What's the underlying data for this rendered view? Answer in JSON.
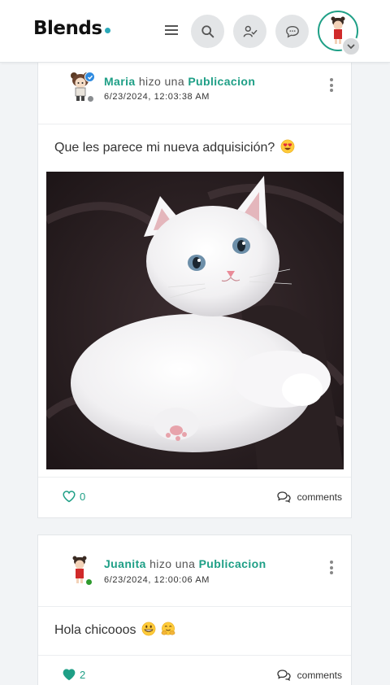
{
  "header": {
    "logo": "Blends",
    "colors": {
      "accent": "#1e9f86",
      "logo_dot": "#2aa8b8"
    },
    "icons": [
      "menu-icon",
      "search-icon",
      "friend-requests-icon",
      "messages-icon",
      "chevron-down-icon"
    ]
  },
  "posts": [
    {
      "author": "Maria",
      "action": "hizo una",
      "type": "Publicacion",
      "date": "6/23/2024, 12:03:38 AM",
      "verified": true,
      "status": "offline",
      "text": "Que les parece mi nueva adquisición?",
      "emojis": [
        "heart-eyes-emoji"
      ],
      "has_image": true,
      "likes": "0",
      "liked": false,
      "comments_label": "comments"
    },
    {
      "author": "Juanita",
      "action": "hizo una",
      "type": "Publicacion",
      "date": "6/23/2024, 12:00:06 AM",
      "verified": false,
      "status": "online",
      "text": "Hola chicooos",
      "emojis": [
        "grinning-emoji",
        "hugging-emoji"
      ],
      "has_image": false,
      "likes": "2",
      "liked": true,
      "comments_label": "comments"
    }
  ]
}
